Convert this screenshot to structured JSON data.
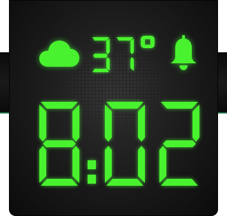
{
  "app": {
    "temperature": "37°",
    "time": "8:02",
    "weather_icon": "cloud-icon",
    "alarm_icon": "bell-icon",
    "digit_color": "#49f22e",
    "background_color": "#1a1a1a"
  }
}
